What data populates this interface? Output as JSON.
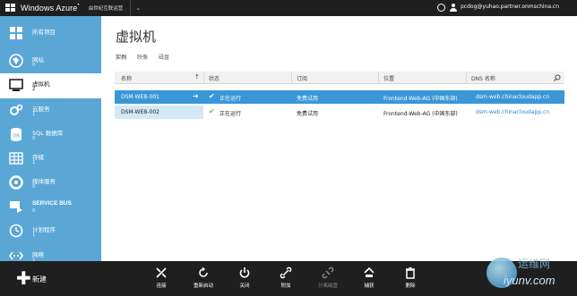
{
  "topbar": {
    "brand": "Windows Azure",
    "brand_mark": "*",
    "provider": "由世纪互联运营",
    "chevron": "⌄",
    "email": "pcdog@yuhao.partner.onmschina.cn"
  },
  "sidebar": {
    "items": [
      {
        "label": "所有项目",
        "count": "",
        "icon": "grid-icon"
      },
      {
        "label": "网站",
        "count": "0",
        "icon": "website-icon"
      },
      {
        "label": "虚拟机",
        "count": "2",
        "icon": "monitor-icon",
        "active": true
      },
      {
        "label": "云服务",
        "count": "1",
        "icon": "gears-icon"
      },
      {
        "label": "SQL 数据库",
        "count": "0",
        "icon": "database-icon"
      },
      {
        "label": "存储",
        "count": "1",
        "icon": "storage-table-icon"
      },
      {
        "label": "媒体服务",
        "count": "0",
        "icon": "media-icon"
      },
      {
        "label": "SERVICE BUS",
        "count": "0",
        "icon": "service-bus-icon"
      },
      {
        "label": "计划程序",
        "count": "1",
        "icon": "clock-icon"
      },
      {
        "label": "网络",
        "count": "1",
        "icon": "network-icon"
      }
    ]
  },
  "main": {
    "title": "虚拟机",
    "tabs": [
      {
        "label": "实例",
        "active": true
      },
      {
        "label": "映像",
        "active": false
      },
      {
        "label": "磁盘",
        "active": false
      }
    ],
    "table": {
      "columns": [
        "名称",
        "状态",
        "订阅",
        "位置",
        "DNS 名称"
      ],
      "rows": [
        {
          "name": "DSM-WEB-001",
          "status": "正在运行",
          "subscription": "免费试用",
          "location": "Frontend-Web-AG (中国东部)",
          "dns": "dsm-web.chinacloudapp.cn"
        },
        {
          "name": "DSM-WEB-002",
          "status": "正在运行",
          "subscription": "免费试用",
          "location": "Frontend-Web-AG (中国东部)",
          "dns": "dsm-web.chinacloudapp.cn"
        }
      ]
    }
  },
  "bottombar": {
    "new_label": "新建",
    "commands": [
      {
        "label": "连接",
        "icon": "connect-icon",
        "enabled": true
      },
      {
        "label": "重新启动",
        "icon": "restart-icon",
        "enabled": true
      },
      {
        "label": "关闭",
        "icon": "power-icon",
        "enabled": true
      },
      {
        "label": "附加",
        "icon": "attach-icon",
        "enabled": true
      },
      {
        "label": "分离磁盘",
        "icon": "detach-disk-icon",
        "enabled": false
      },
      {
        "label": "捕获",
        "icon": "capture-icon",
        "enabled": true
      },
      {
        "label": "删除",
        "icon": "trash-icon",
        "enabled": true
      }
    ]
  },
  "watermark": {
    "line1": "运维网",
    "line2": "iyunv.com"
  },
  "colors": {
    "sidebar": "#5aa7d6",
    "selected_row": "#3a97d7",
    "running_check": "#7ab541",
    "bars": "#1f1f1f",
    "link": "#2d89ce"
  }
}
